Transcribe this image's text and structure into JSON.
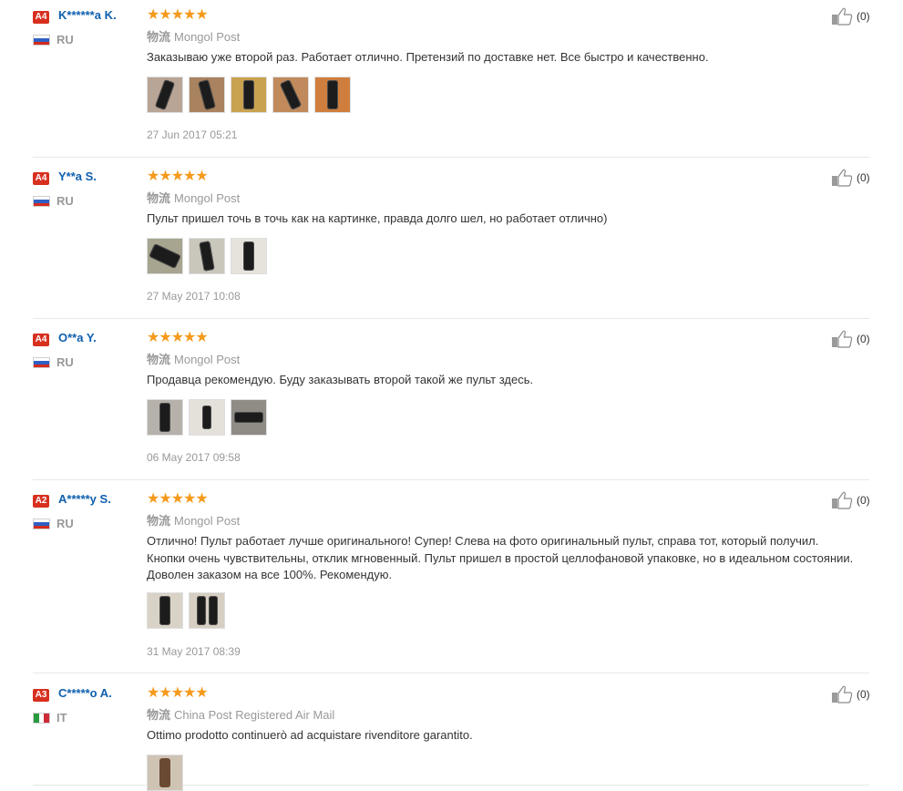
{
  "reviews": [
    {
      "badge": "A4",
      "user": "K******a K.",
      "country": "RU",
      "stars": "★★★★★",
      "logistics_label": "物流",
      "logistics": "Mongol Post",
      "text": "Заказываю уже второй раз. Работает отлично. Претензий по доставке нет. Все быстро и качественно.",
      "date": "27 Jun 2017 05:21",
      "likes": "(0)"
    },
    {
      "badge": "A4",
      "user": "Y**a S.",
      "country": "RU",
      "stars": "★★★★★",
      "logistics_label": "物流",
      "logistics": "Mongol Post",
      "text": "Пульт пришел точь в точь как на картинке, правда долго шел, но работает отлично)",
      "date": "27 May 2017 10:08",
      "likes": "(0)"
    },
    {
      "badge": "A4",
      "user": "O**a Y.",
      "country": "RU",
      "stars": "★★★★★",
      "logistics_label": "物流",
      "logistics": "Mongol Post",
      "text": "Продавца рекомендую. Буду заказывать второй такой же пульт здесь.",
      "date": "06 May 2017 09:58",
      "likes": "(0)"
    },
    {
      "badge": "A2",
      "user": "A*****y S.",
      "country": "RU",
      "stars": "★★★★★",
      "logistics_label": "物流",
      "logistics": "Mongol Post",
      "text": "Отлично! Пульт работает лучше оригинального! Супер! Слева на фото оригинальный пульт, справа тот, который получил. Кнопки очень чувствительны, отклик мгновенный. Пульт пришел в простой целлофановой упаковке, но в идеальном состоянии. Доволен заказом на все 100%. Рекомендую.",
      "date": "31 May 2017 08:39",
      "likes": "(0)"
    },
    {
      "badge": "A3",
      "user": "C*****o A.",
      "country": "IT",
      "stars": "★★★★★",
      "logistics_label": "物流",
      "logistics": "China Post Registered Air Mail",
      "text": "Ottimo prodotto continuerò ad acquistare rivenditore garantito.",
      "date": "",
      "likes": "(0)"
    }
  ],
  "colors": {
    "badge": "#d7301f",
    "username": "#0e5fae",
    "stars": "#f59a1c",
    "muted": "#999999",
    "flag_ru": [
      "#ffffff",
      "#2f5fc4",
      "#d52b1e"
    ],
    "flag_it": [
      "#2a9a3f",
      "#ffffff",
      "#ce2b37"
    ]
  },
  "icons": {
    "like": "thumbs-up-icon",
    "flag": "country-flag-icon",
    "rating": "star-icon"
  }
}
